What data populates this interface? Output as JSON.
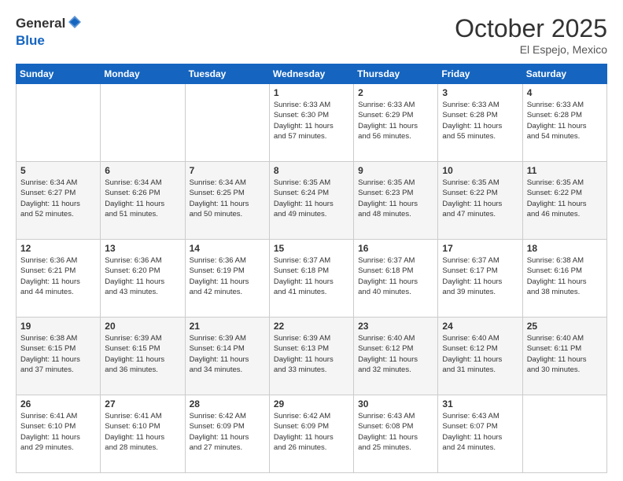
{
  "header": {
    "logo_general": "General",
    "logo_blue": "Blue",
    "month_title": "October 2025",
    "location": "El Espejo, Mexico"
  },
  "days_of_week": [
    "Sunday",
    "Monday",
    "Tuesday",
    "Wednesday",
    "Thursday",
    "Friday",
    "Saturday"
  ],
  "weeks": [
    [
      {
        "day": "",
        "info": ""
      },
      {
        "day": "",
        "info": ""
      },
      {
        "day": "",
        "info": ""
      },
      {
        "day": "1",
        "info": "Sunrise: 6:33 AM\nSunset: 6:30 PM\nDaylight: 11 hours\nand 57 minutes."
      },
      {
        "day": "2",
        "info": "Sunrise: 6:33 AM\nSunset: 6:29 PM\nDaylight: 11 hours\nand 56 minutes."
      },
      {
        "day": "3",
        "info": "Sunrise: 6:33 AM\nSunset: 6:28 PM\nDaylight: 11 hours\nand 55 minutes."
      },
      {
        "day": "4",
        "info": "Sunrise: 6:33 AM\nSunset: 6:28 PM\nDaylight: 11 hours\nand 54 minutes."
      }
    ],
    [
      {
        "day": "5",
        "info": "Sunrise: 6:34 AM\nSunset: 6:27 PM\nDaylight: 11 hours\nand 52 minutes."
      },
      {
        "day": "6",
        "info": "Sunrise: 6:34 AM\nSunset: 6:26 PM\nDaylight: 11 hours\nand 51 minutes."
      },
      {
        "day": "7",
        "info": "Sunrise: 6:34 AM\nSunset: 6:25 PM\nDaylight: 11 hours\nand 50 minutes."
      },
      {
        "day": "8",
        "info": "Sunrise: 6:35 AM\nSunset: 6:24 PM\nDaylight: 11 hours\nand 49 minutes."
      },
      {
        "day": "9",
        "info": "Sunrise: 6:35 AM\nSunset: 6:23 PM\nDaylight: 11 hours\nand 48 minutes."
      },
      {
        "day": "10",
        "info": "Sunrise: 6:35 AM\nSunset: 6:22 PM\nDaylight: 11 hours\nand 47 minutes."
      },
      {
        "day": "11",
        "info": "Sunrise: 6:35 AM\nSunset: 6:22 PM\nDaylight: 11 hours\nand 46 minutes."
      }
    ],
    [
      {
        "day": "12",
        "info": "Sunrise: 6:36 AM\nSunset: 6:21 PM\nDaylight: 11 hours\nand 44 minutes."
      },
      {
        "day": "13",
        "info": "Sunrise: 6:36 AM\nSunset: 6:20 PM\nDaylight: 11 hours\nand 43 minutes."
      },
      {
        "day": "14",
        "info": "Sunrise: 6:36 AM\nSunset: 6:19 PM\nDaylight: 11 hours\nand 42 minutes."
      },
      {
        "day": "15",
        "info": "Sunrise: 6:37 AM\nSunset: 6:18 PM\nDaylight: 11 hours\nand 41 minutes."
      },
      {
        "day": "16",
        "info": "Sunrise: 6:37 AM\nSunset: 6:18 PM\nDaylight: 11 hours\nand 40 minutes."
      },
      {
        "day": "17",
        "info": "Sunrise: 6:37 AM\nSunset: 6:17 PM\nDaylight: 11 hours\nand 39 minutes."
      },
      {
        "day": "18",
        "info": "Sunrise: 6:38 AM\nSunset: 6:16 PM\nDaylight: 11 hours\nand 38 minutes."
      }
    ],
    [
      {
        "day": "19",
        "info": "Sunrise: 6:38 AM\nSunset: 6:15 PM\nDaylight: 11 hours\nand 37 minutes."
      },
      {
        "day": "20",
        "info": "Sunrise: 6:39 AM\nSunset: 6:15 PM\nDaylight: 11 hours\nand 36 minutes."
      },
      {
        "day": "21",
        "info": "Sunrise: 6:39 AM\nSunset: 6:14 PM\nDaylight: 11 hours\nand 34 minutes."
      },
      {
        "day": "22",
        "info": "Sunrise: 6:39 AM\nSunset: 6:13 PM\nDaylight: 11 hours\nand 33 minutes."
      },
      {
        "day": "23",
        "info": "Sunrise: 6:40 AM\nSunset: 6:12 PM\nDaylight: 11 hours\nand 32 minutes."
      },
      {
        "day": "24",
        "info": "Sunrise: 6:40 AM\nSunset: 6:12 PM\nDaylight: 11 hours\nand 31 minutes."
      },
      {
        "day": "25",
        "info": "Sunrise: 6:40 AM\nSunset: 6:11 PM\nDaylight: 11 hours\nand 30 minutes."
      }
    ],
    [
      {
        "day": "26",
        "info": "Sunrise: 6:41 AM\nSunset: 6:10 PM\nDaylight: 11 hours\nand 29 minutes."
      },
      {
        "day": "27",
        "info": "Sunrise: 6:41 AM\nSunset: 6:10 PM\nDaylight: 11 hours\nand 28 minutes."
      },
      {
        "day": "28",
        "info": "Sunrise: 6:42 AM\nSunset: 6:09 PM\nDaylight: 11 hours\nand 27 minutes."
      },
      {
        "day": "29",
        "info": "Sunrise: 6:42 AM\nSunset: 6:09 PM\nDaylight: 11 hours\nand 26 minutes."
      },
      {
        "day": "30",
        "info": "Sunrise: 6:43 AM\nSunset: 6:08 PM\nDaylight: 11 hours\nand 25 minutes."
      },
      {
        "day": "31",
        "info": "Sunrise: 6:43 AM\nSunset: 6:07 PM\nDaylight: 11 hours\nand 24 minutes."
      },
      {
        "day": "",
        "info": ""
      }
    ]
  ]
}
